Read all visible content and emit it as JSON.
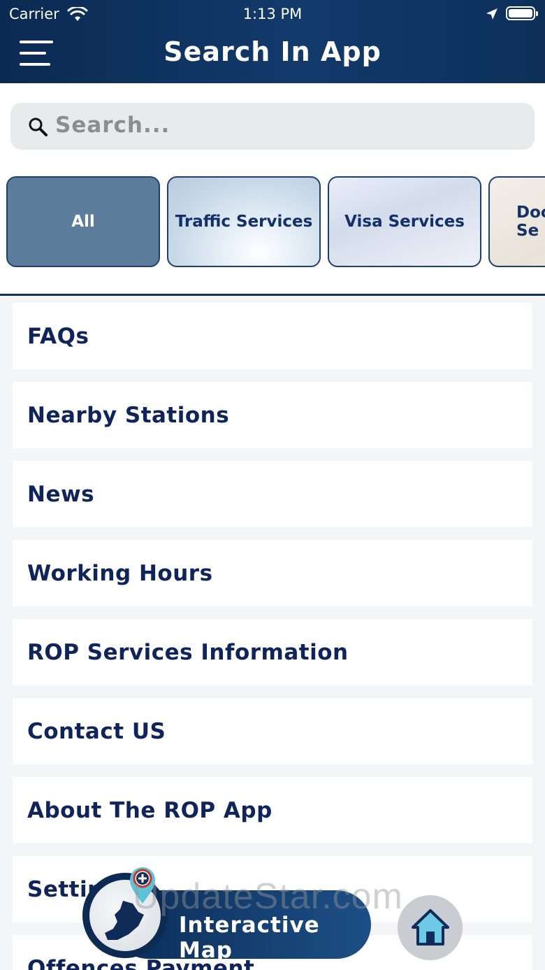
{
  "status_bar": {
    "carrier": "Carrier",
    "time": "1:13 PM"
  },
  "header": {
    "title": "Search In App"
  },
  "search": {
    "placeholder": "Search..."
  },
  "categories": [
    {
      "label": "All",
      "selected": true
    },
    {
      "label": "Traffic Services",
      "selected": false
    },
    {
      "label": "Visa Services",
      "selected": false
    },
    {
      "label": "Doc Se",
      "selected": false
    }
  ],
  "list_items": [
    "FAQs",
    "Nearby Stations",
    "News",
    "Working Hours",
    "ROP Services Information",
    "Contact US",
    "About The ROP App",
    "Settings",
    "Offences Payment"
  ],
  "bottom": {
    "map_label": "Interactive Map"
  },
  "watermark": "UpdateStar.com",
  "colors": {
    "header": "#0b2a52",
    "accent_text": "#0f245a",
    "selected_category": "#5c7d9c"
  }
}
